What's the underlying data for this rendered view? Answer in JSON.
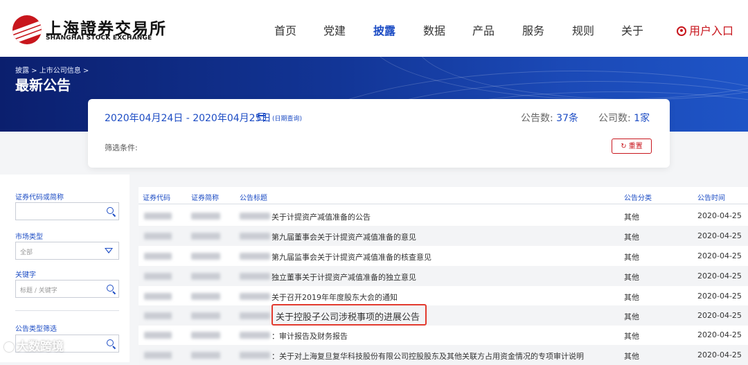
{
  "header": {
    "logo_cn": "上海證券交易所",
    "logo_en": "SHANGHAI STOCK EXCHANGE",
    "nav": [
      {
        "label": "首页",
        "active": false
      },
      {
        "label": "党建",
        "active": false
      },
      {
        "label": "披露",
        "active": true
      },
      {
        "label": "数据",
        "active": false
      },
      {
        "label": "产品",
        "active": false
      },
      {
        "label": "服务",
        "active": false
      },
      {
        "label": "规则",
        "active": false
      },
      {
        "label": "关于",
        "active": false
      }
    ],
    "user_entry": "用户入口"
  },
  "banner": {
    "breadcrumb": "披露 > 上市公司信息 >",
    "title": "最新公告"
  },
  "summary": {
    "date_range": "2020年04月24日 - 2020年04月25日",
    "date_query": "(日期查询)",
    "announcement_count_label": "公告数:",
    "announcement_count_value": "37条",
    "company_count_label": "公司数:",
    "company_count_value": "1家",
    "filter_label": "筛选条件:",
    "reset_label": "重置"
  },
  "filters": {
    "code_label": "证券代码或简称",
    "code_value": "",
    "market_label": "市场类型",
    "market_value": "全部",
    "keyword_label": "关键字",
    "keyword_placeholder": "标题 / 关键字",
    "type_label": "公告类型筛选",
    "type_value": ""
  },
  "table": {
    "headers": {
      "code": "证券代码",
      "name": "证券简称",
      "title": "公告标题",
      "category": "公告分类",
      "time": "公告时间"
    },
    "rows": [
      {
        "title": "关于计提资产减值准备的公告",
        "category": "其他",
        "time": "2020-04-25"
      },
      {
        "title": "第九届董事会关于计提资产减值准备的意见",
        "category": "其他",
        "time": "2020-04-25"
      },
      {
        "title": "第九届监事会关于计提资产减值准备的核查意见",
        "category": "其他",
        "time": "2020-04-25"
      },
      {
        "title": "独立董事关于计提资产减值准备的独立意见",
        "category": "其他",
        "time": "2020-04-25"
      },
      {
        "title": "关于召开2019年年度股东大会的通知",
        "category": "其他",
        "time": "2020-04-25"
      },
      {
        "title": "关于控股子公司涉税事项的进展公告",
        "category": "其他",
        "time": "2020-04-25"
      },
      {
        "title": "：审计报告及财务报告",
        "category": "其他",
        "time": "2020-04-25"
      },
      {
        "title": "：关于对上海复旦复华科技股份有限公司控股股东及其他关联方占用资金情况的专项审计说明",
        "category": "其他",
        "time": "2020-04-25"
      }
    ]
  },
  "watermark": "大数跨境",
  "colors": {
    "brand_red": "#c8161d",
    "accent_blue": "#1c4cc4",
    "banner_dark": "#0b1f6e",
    "highlight_red": "#e23a2e"
  }
}
